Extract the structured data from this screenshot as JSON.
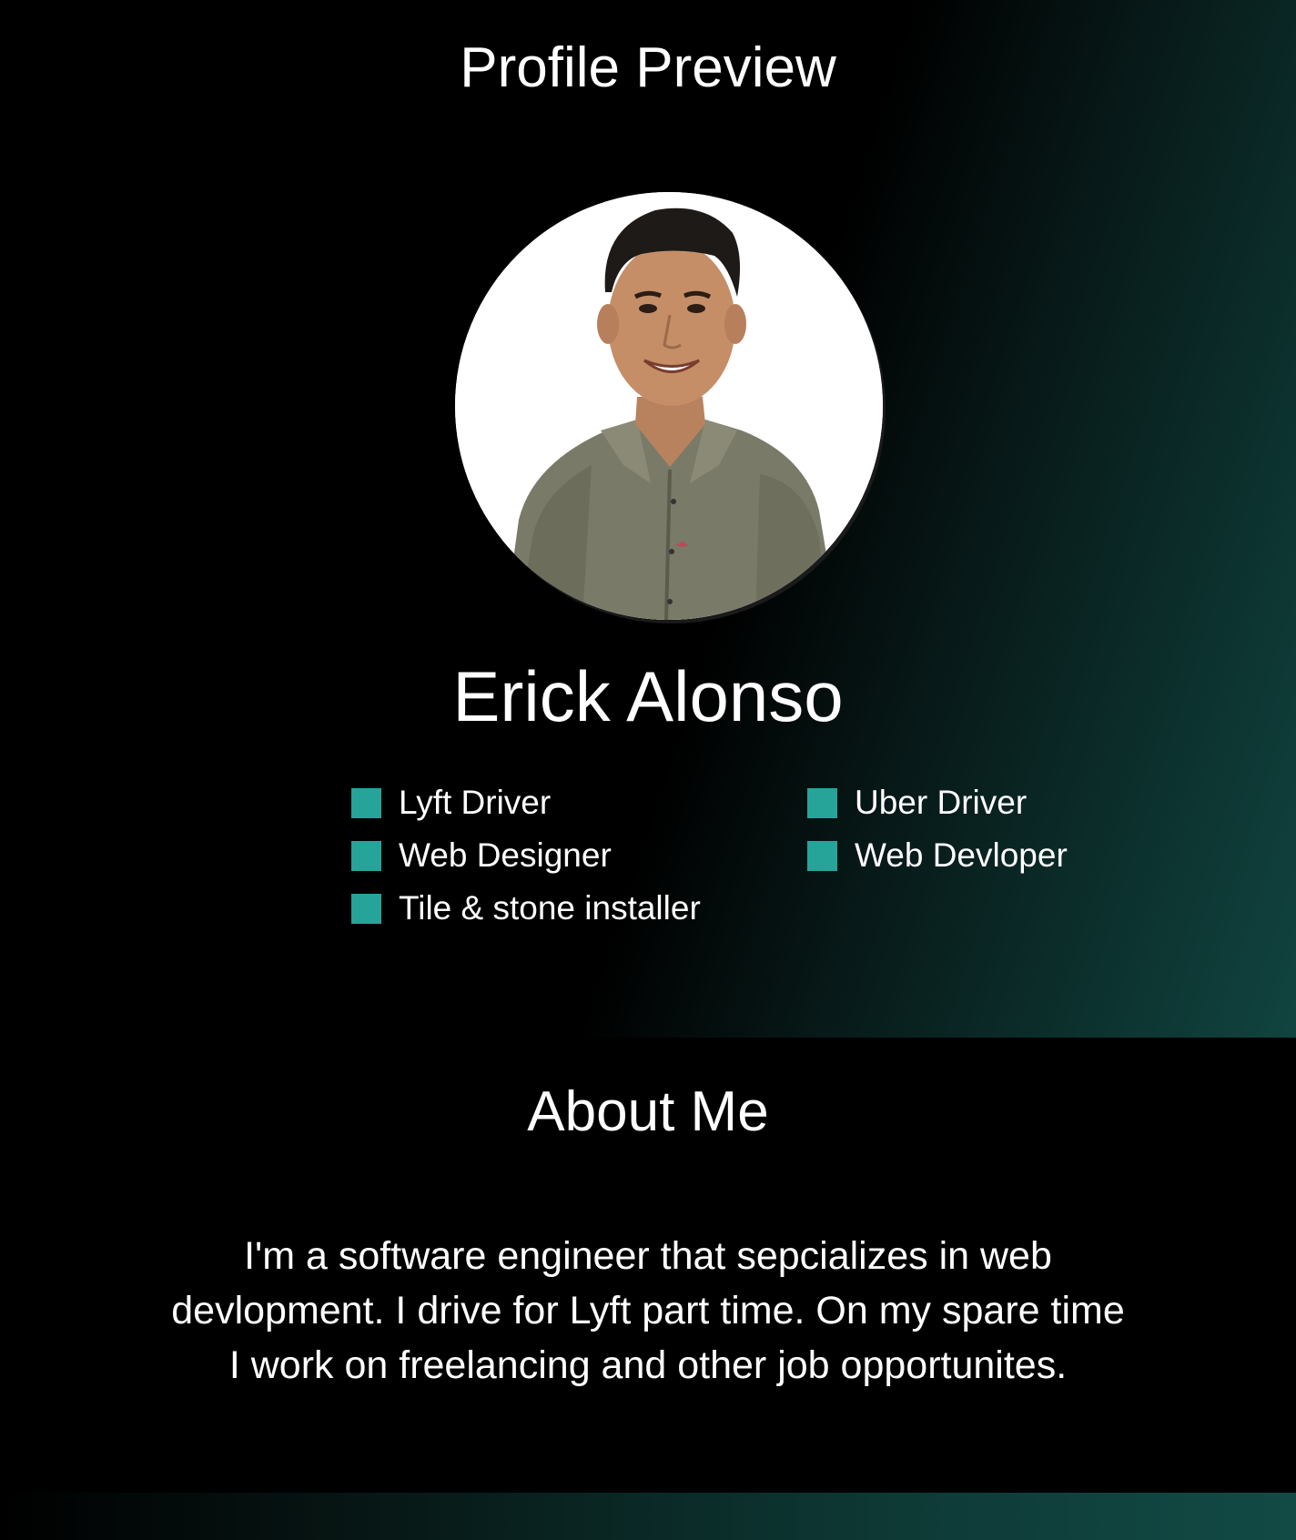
{
  "header": {
    "title": "Profile Preview"
  },
  "profile": {
    "avatar_icon": "profile-photo",
    "name": "Erick Alonso",
    "bullet_color": "#26a49a",
    "roles": [
      {
        "label": "Lyft Driver"
      },
      {
        "label": "Uber Driver"
      },
      {
        "label": "Web Designer"
      },
      {
        "label": "Web Devloper"
      },
      {
        "label": "Tile & stone installer"
      }
    ]
  },
  "about": {
    "title": "About Me",
    "text": "I'm a software engineer that sepcializes in web devlopment. I drive for Lyft part time. On my spare time I work on freelancing and other job opportunites."
  },
  "theme": {
    "background": "#000000",
    "accent_gradient_end": "#114440",
    "accent": "#26a49a"
  }
}
